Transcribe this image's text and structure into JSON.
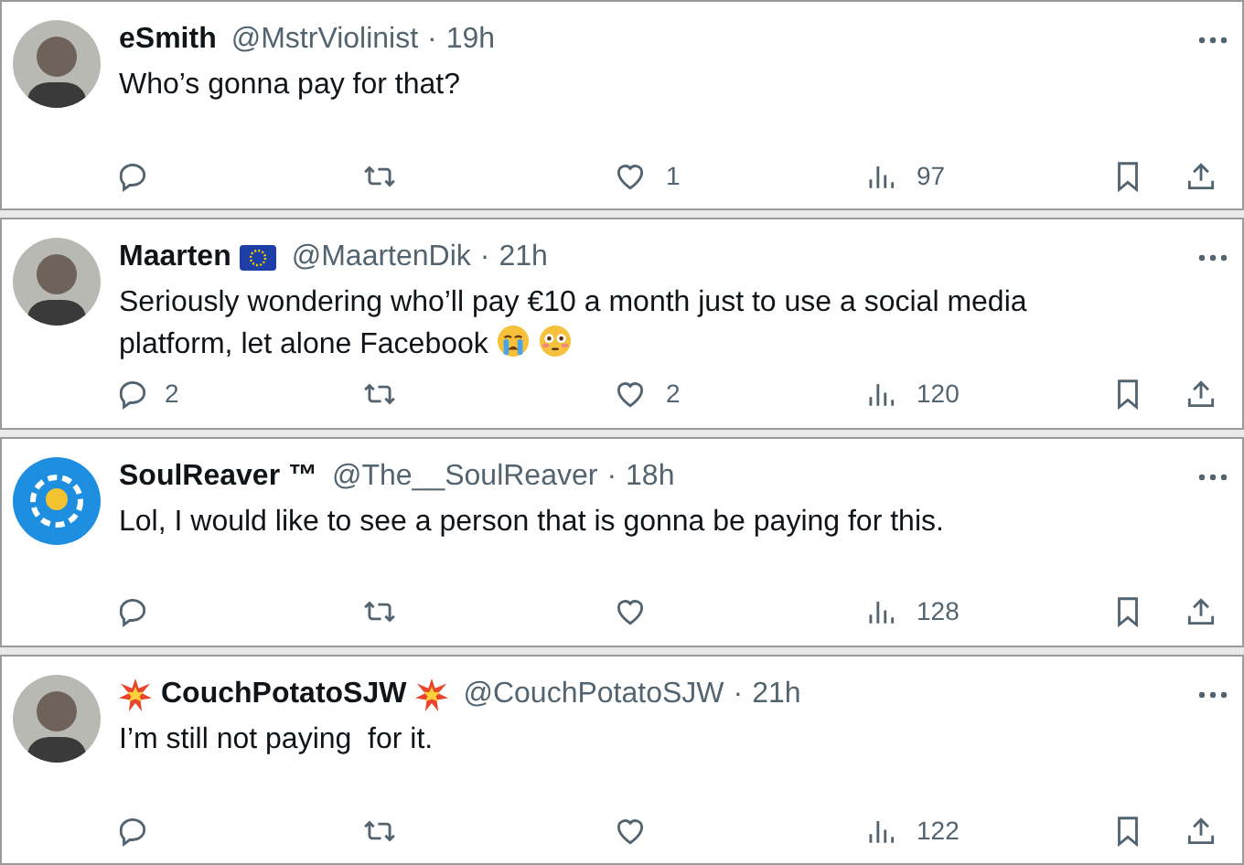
{
  "tweets": [
    {
      "avatar": {
        "kind": "person"
      },
      "name": "eSmith",
      "handle": "@MstrViolinist",
      "separator": "·",
      "time": "19h",
      "text": "Who’s gonna pay for that?",
      "likes": "1",
      "views": "97"
    },
    {
      "avatar": {
        "kind": "person"
      },
      "name": "Maarten",
      "name_suffix_icon": {
        "kind": "flag"
      },
      "handle": "@MaartenDik",
      "separator": "·",
      "time": "21h",
      "text": "Seriously wondering who’ll pay €10 a month just to use a social media platform, let alone Facebook",
      "text_emojis": [
        {
          "kind": "crying"
        },
        {
          "kind": "flushed"
        }
      ],
      "replies": "2",
      "likes": "2",
      "views": "120"
    },
    {
      "avatar": {
        "kind": "emblem"
      },
      "name": "SoulReaver ™",
      "handle": "@The__SoulReaver",
      "separator": "·",
      "time": "18h",
      "text": "Lol, I would like to see a person that is gonna be paying for this.",
      "views": "128"
    },
    {
      "avatar": {
        "kind": "person"
      },
      "name": "CouchPotatoSJW",
      "name_prefix_icon": {
        "kind": "burst"
      },
      "name_suffix_icon": {
        "kind": "burst"
      },
      "handle": "@CouchPotatoSJW",
      "separator": "·",
      "time": "21h",
      "text": "I’m still not paying  for it.",
      "views": "122"
    }
  ]
}
